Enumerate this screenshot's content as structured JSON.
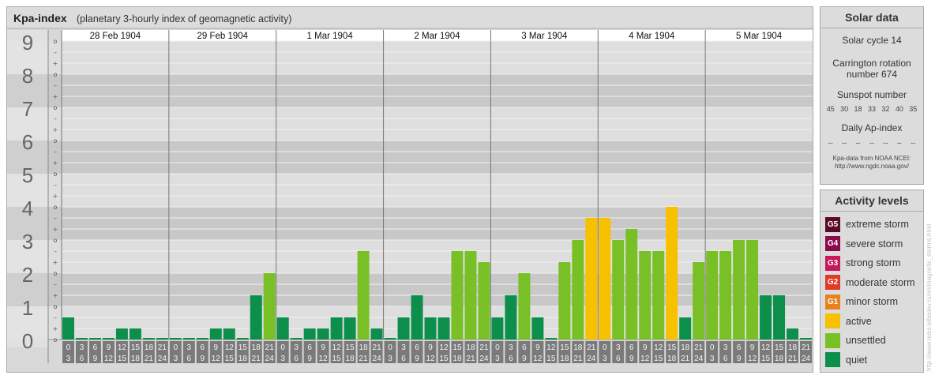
{
  "title": "Kpa-index",
  "subtitle": "(planetary 3-hourly index of geomagnetic activity)",
  "chart_data": {
    "type": "bar",
    "title": "Kpa-index",
    "subtitle": "(planetary 3-hourly index of geomagnetic activity)",
    "ylim": [
      0,
      9
    ],
    "y_major_ticks": [
      "0",
      "1",
      "2",
      "3",
      "4",
      "5",
      "6",
      "7",
      "8",
      "9"
    ],
    "y_minor_marks": [
      "o",
      "+",
      "–"
    ],
    "days": [
      "28 Feb 1904",
      "29 Feb 1904",
      "1 Mar 1904",
      "2 Mar 1904",
      "3 Mar 1904",
      "4 Mar 1904",
      "5 Mar 1904"
    ],
    "interval_labels": [
      {
        "start": "0",
        "end": "3"
      },
      {
        "start": "3",
        "end": "6"
      },
      {
        "start": "6",
        "end": "9"
      },
      {
        "start": "9",
        "end": "12"
      },
      {
        "start": "12",
        "end": "15"
      },
      {
        "start": "15",
        "end": "18"
      },
      {
        "start": "18",
        "end": "21"
      },
      {
        "start": "21",
        "end": "24"
      }
    ],
    "values": [
      0.667,
      0,
      0,
      0,
      0.333,
      0.333,
      0,
      0,
      0,
      0,
      0,
      0.333,
      0.333,
      0,
      1.333,
      2,
      0.667,
      0,
      0.333,
      0.333,
      0.667,
      0.667,
      2.667,
      0.333,
      0,
      0.667,
      1.333,
      0.667,
      0.667,
      2.667,
      2.667,
      2.333,
      0.667,
      1.333,
      2,
      0.667,
      0,
      2.333,
      3,
      3.667,
      3.667,
      3,
      3.333,
      2.667,
      2.667,
      4,
      0.667,
      2.333,
      2.667,
      2.667,
      3,
      3,
      1.333,
      1.333,
      0.333,
      0
    ],
    "level_colors": {
      "quiet": "#0b8f4a",
      "unsettled": "#78c025",
      "active": "#f7c100"
    }
  },
  "solar": {
    "title": "Solar data",
    "cycle": "Solar cycle 14",
    "carrington_line1": "Carrington rotation",
    "carrington_line2": "number 674",
    "sunspot_title": "Sunspot number",
    "sunspots": [
      "45",
      "30",
      "18",
      "33",
      "32",
      "40",
      "35"
    ],
    "ap_title": "Daily Ap-index",
    "ap_values": [
      "--",
      "--",
      "--",
      "--",
      "--",
      "--",
      "--"
    ],
    "source_line1": "Kpa-data from NOAA NCEI:",
    "source_line2": "http://www.ngdc.noaa.gov/"
  },
  "activity": {
    "title": "Activity levels",
    "items": [
      {
        "code": "G5",
        "label": "extreme storm",
        "color": "#5a0a2a"
      },
      {
        "code": "G4",
        "label": "severe storm",
        "color": "#8b0a4a"
      },
      {
        "code": "G3",
        "label": "strong storm",
        "color": "#c8185a"
      },
      {
        "code": "G2",
        "label": "moderate storm",
        "color": "#e03a2a"
      },
      {
        "code": "G1",
        "label": "minor storm",
        "color": "#e8821e"
      },
      {
        "code": "",
        "label": "active",
        "color": "#f7c100"
      },
      {
        "code": "",
        "label": "unsettled",
        "color": "#78c025"
      },
      {
        "code": "",
        "label": "quiet",
        "color": "#0b8f4a"
      }
    ]
  },
  "credit": "http://www.tesis.lebedev.ru/en/magnetic_storms.html"
}
